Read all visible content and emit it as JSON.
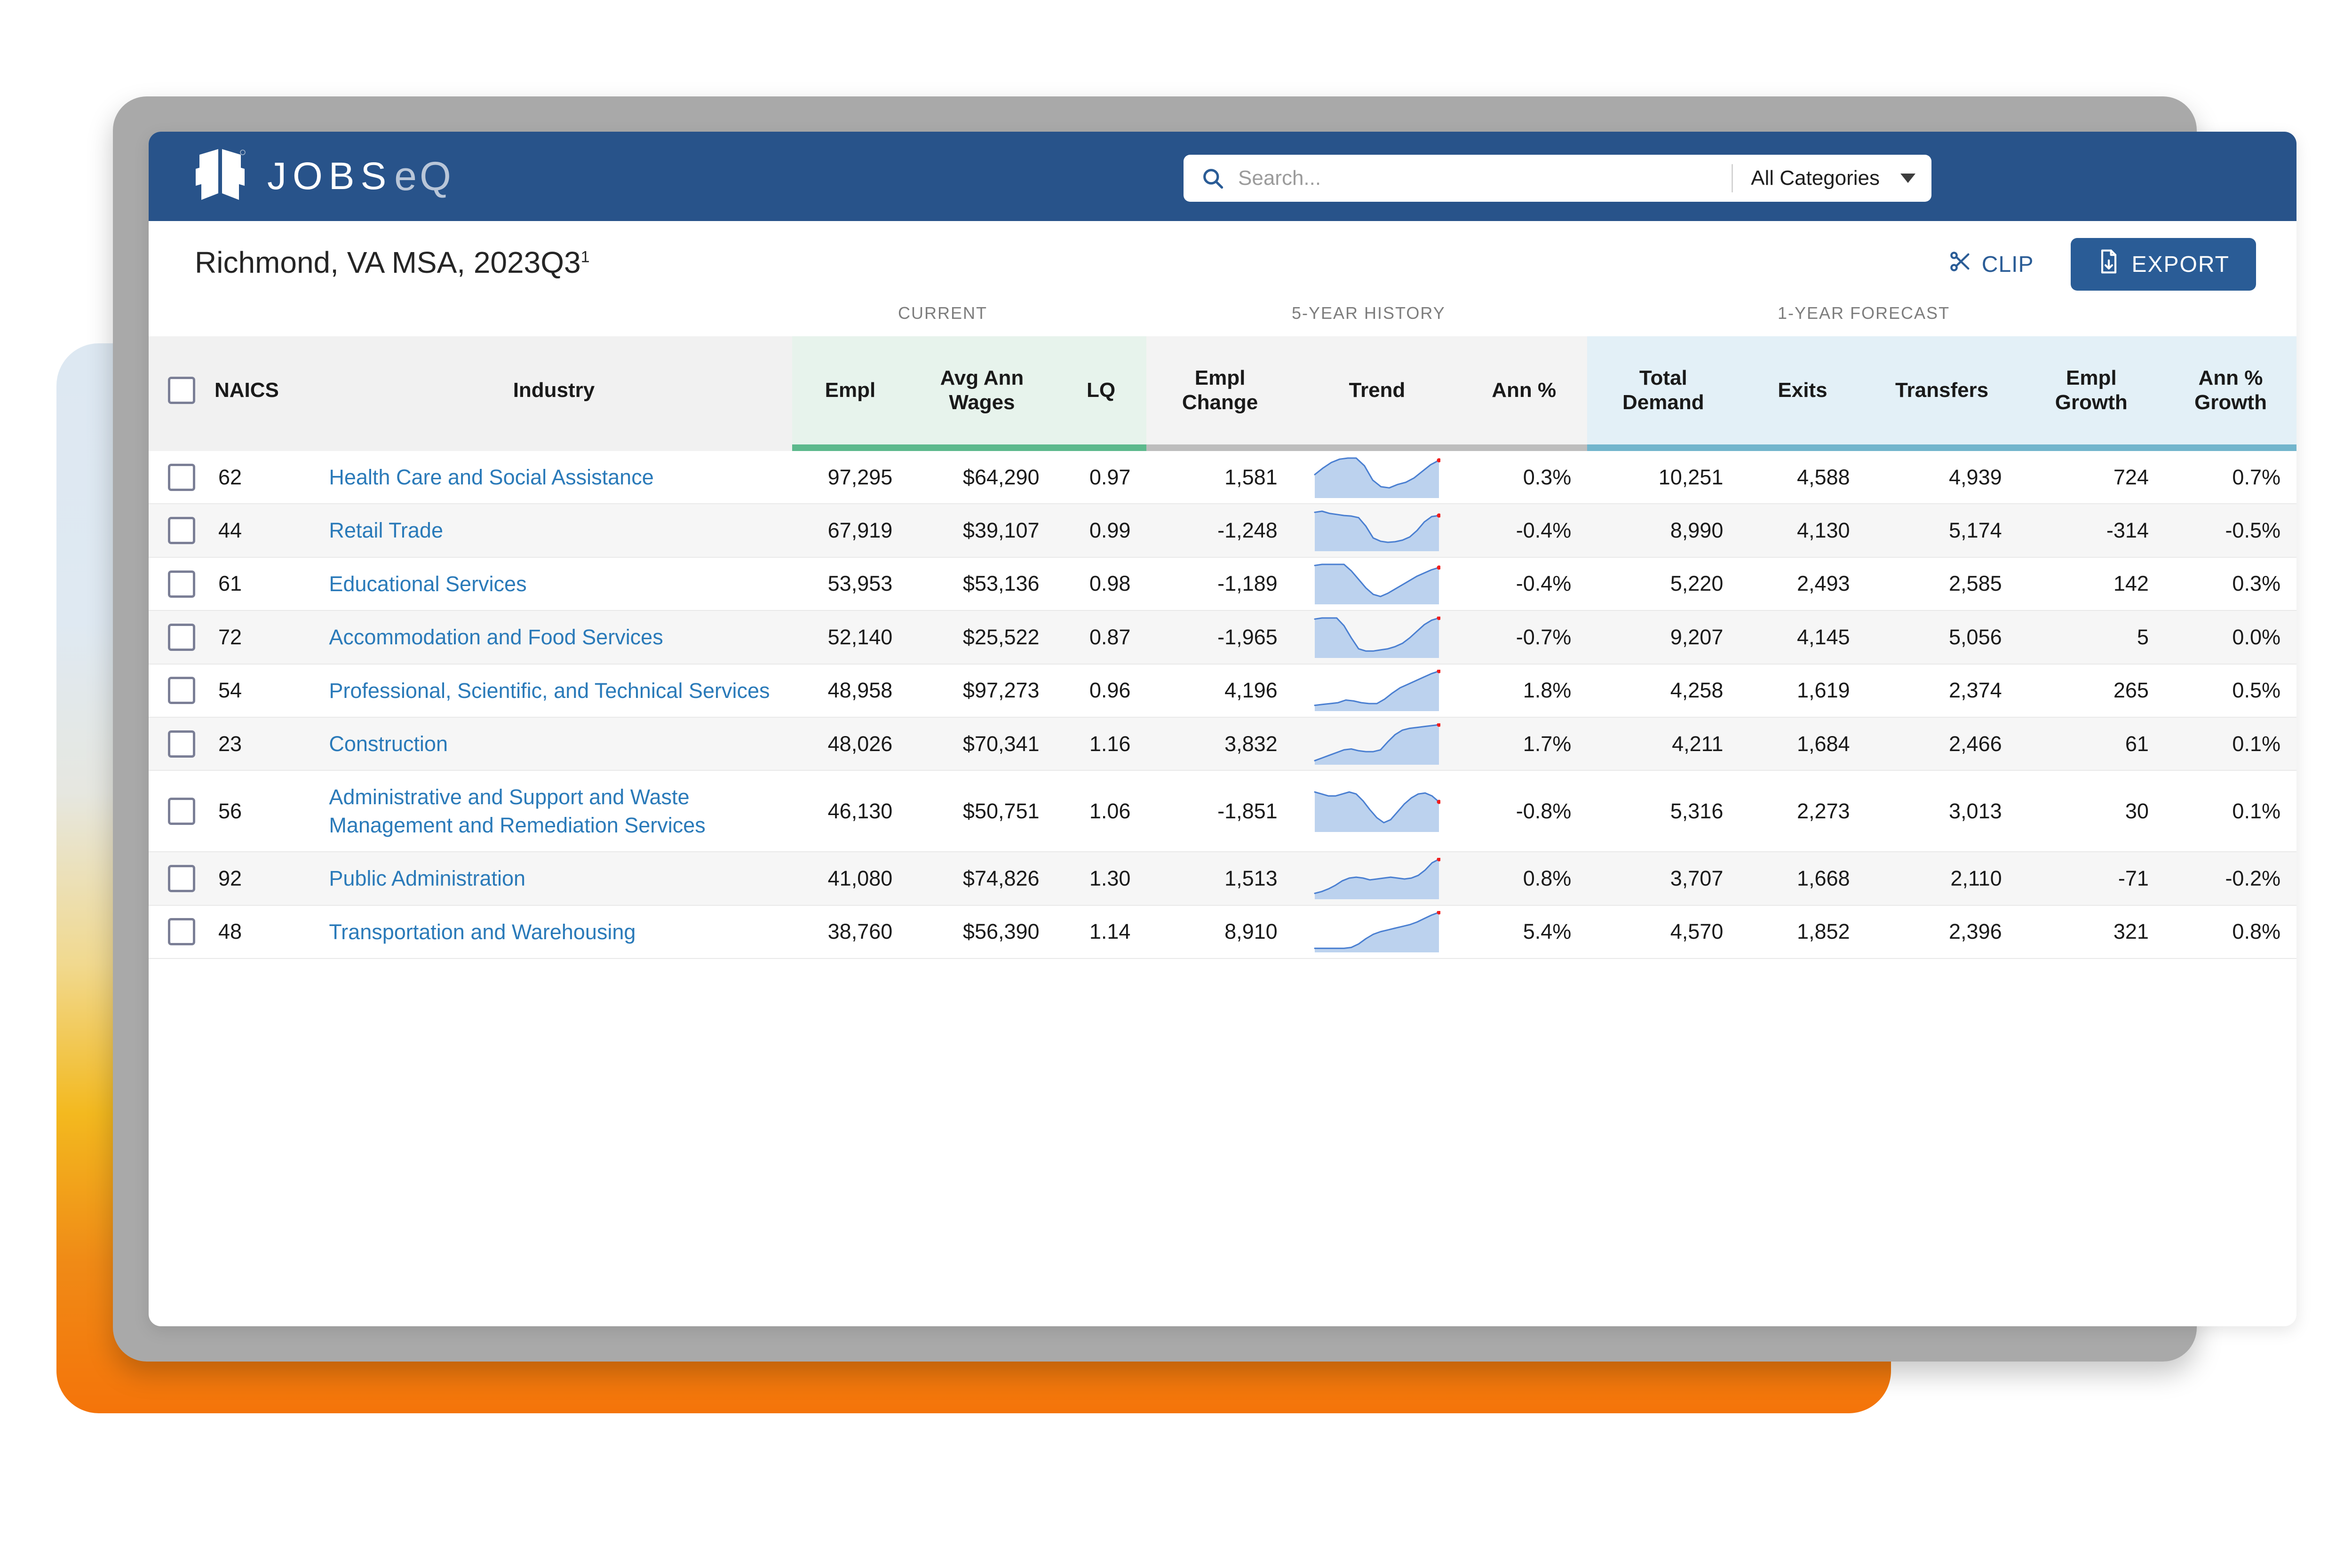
{
  "brand": {
    "name_primary": "JOBS",
    "name_secondary": "eQ",
    "logo_icon": "stacked-chevron-logo-icon"
  },
  "search": {
    "placeholder": "Search...",
    "value": "",
    "category_selected": "All Categories",
    "icon": "search-icon",
    "caret_icon": "chevron-down-icon"
  },
  "header": {
    "title": "Richmond, VA MSA, 2023Q3",
    "title_superscript": "1",
    "clip_label": "CLIP",
    "clip_icon": "scissors-icon",
    "export_label": "EXPORT",
    "export_icon": "file-download-icon"
  },
  "groups": {
    "current": "CURRENT",
    "history": "5-YEAR HISTORY",
    "forecast": "1-YEAR FORECAST"
  },
  "columns": {
    "naics": "NAICS",
    "industry": "Industry",
    "empl": "Empl",
    "avg_ann_wages_l1": "Avg Ann",
    "avg_ann_wages_l2": "Wages",
    "lq": "LQ",
    "empl_change_l1": "Empl",
    "empl_change_l2": "Change",
    "trend": "Trend",
    "ann_pct": "Ann %",
    "total_demand_l1": "Total",
    "total_demand_l2": "Demand",
    "exits": "Exits",
    "transfers": "Transfers",
    "empl_growth_l1": "Empl",
    "empl_growth_l2": "Growth",
    "ann_pct_growth_l1": "Ann %",
    "ann_pct_growth_l2": "Growth"
  },
  "colors": {
    "brand_blue": "#28538a",
    "link_blue": "#2a7ab9",
    "current_band": "#5cb98c",
    "history_band": "#bdbdbd",
    "forecast_band": "#72b5cc",
    "spark_line": "#4a7fd1",
    "spark_fill": "#bcd2ee",
    "spark_marker": "#f01e1e"
  },
  "rows": [
    {
      "naics": "62",
      "industry": "Health Care and Social Assistance",
      "empl": "97,295",
      "wages": "$64,290",
      "lq": "0.97",
      "empl_change": "1,581",
      "ann_pct": "0.3%",
      "total_demand": "10,251",
      "exits": "4,588",
      "transfers": "4,939",
      "empl_growth": "724",
      "ann_pct_growth": "0.7%"
    },
    {
      "naics": "44",
      "industry": "Retail Trade",
      "empl": "67,919",
      "wages": "$39,107",
      "lq": "0.99",
      "empl_change": "-1,248",
      "ann_pct": "-0.4%",
      "total_demand": "8,990",
      "exits": "4,130",
      "transfers": "5,174",
      "empl_growth": "-314",
      "ann_pct_growth": "-0.5%"
    },
    {
      "naics": "61",
      "industry": "Educational Services",
      "empl": "53,953",
      "wages": "$53,136",
      "lq": "0.98",
      "empl_change": "-1,189",
      "ann_pct": "-0.4%",
      "total_demand": "5,220",
      "exits": "2,493",
      "transfers": "2,585",
      "empl_growth": "142",
      "ann_pct_growth": "0.3%"
    },
    {
      "naics": "72",
      "industry": "Accommodation and Food Services",
      "empl": "52,140",
      "wages": "$25,522",
      "lq": "0.87",
      "empl_change": "-1,965",
      "ann_pct": "-0.7%",
      "total_demand": "9,207",
      "exits": "4,145",
      "transfers": "5,056",
      "empl_growth": "5",
      "ann_pct_growth": "0.0%"
    },
    {
      "naics": "54",
      "industry": "Professional, Scientific, and Technical Services",
      "empl": "48,958",
      "wages": "$97,273",
      "lq": "0.96",
      "empl_change": "4,196",
      "ann_pct": "1.8%",
      "total_demand": "4,258",
      "exits": "1,619",
      "transfers": "2,374",
      "empl_growth": "265",
      "ann_pct_growth": "0.5%"
    },
    {
      "naics": "23",
      "industry": "Construction",
      "empl": "48,026",
      "wages": "$70,341",
      "lq": "1.16",
      "empl_change": "3,832",
      "ann_pct": "1.7%",
      "total_demand": "4,211",
      "exits": "1,684",
      "transfers": "2,466",
      "empl_growth": "61",
      "ann_pct_growth": "0.1%"
    },
    {
      "naics": "56",
      "industry": "Administrative and Support and Waste Management and Remediation Services",
      "empl": "46,130",
      "wages": "$50,751",
      "lq": "1.06",
      "empl_change": "-1,851",
      "ann_pct": "-0.8%",
      "total_demand": "5,316",
      "exits": "2,273",
      "transfers": "3,013",
      "empl_growth": "30",
      "ann_pct_growth": "0.1%"
    },
    {
      "naics": "92",
      "industry": "Public Administration",
      "empl": "41,080",
      "wages": "$74,826",
      "lq": "1.30",
      "empl_change": "1,513",
      "ann_pct": "0.8%",
      "total_demand": "3,707",
      "exits": "1,668",
      "transfers": "2,110",
      "empl_growth": "-71",
      "ann_pct_growth": "-0.2%"
    },
    {
      "naics": "48",
      "industry": "Transportation and Warehousing",
      "empl": "38,760",
      "wages": "$56,390",
      "lq": "1.14",
      "empl_change": "8,910",
      "ann_pct": "5.4%",
      "total_demand": "4,570",
      "exits": "1,852",
      "transfers": "2,396",
      "empl_growth": "321",
      "ann_pct_growth": "0.8%"
    }
  ],
  "chart_data": [
    {
      "type": "area",
      "title": "Trend 5-Year History — Health Care and Social Assistance",
      "x": [
        0,
        1,
        2,
        3,
        4,
        5,
        6,
        7,
        8,
        9,
        10,
        11,
        12
      ],
      "values": [
        40,
        52,
        62,
        68,
        70,
        70,
        56,
        30,
        18,
        16,
        22,
        26,
        34,
        46,
        58,
        66
      ]
    },
    {
      "type": "area",
      "title": "Trend 5-Year History — Retail Trade",
      "values": [
        70,
        72,
        68,
        66,
        64,
        63,
        60,
        44,
        22,
        16,
        14,
        15,
        18,
        24,
        36,
        52,
        62,
        64
      ]
    },
    {
      "type": "area",
      "title": "Trend 5-Year History — Educational Services",
      "values": [
        70,
        72,
        72,
        72,
        72,
        60,
        44,
        28,
        16,
        12,
        18,
        26,
        34,
        42,
        50,
        56,
        62,
        66
      ]
    },
    {
      "type": "area",
      "title": "Trend 5-Year History — Accommodation and Food Services",
      "values": [
        68,
        70,
        70,
        70,
        56,
        34,
        14,
        10,
        10,
        12,
        14,
        18,
        24,
        34,
        46,
        58,
        66,
        70
      ]
    },
    {
      "type": "area",
      "title": "Trend 5-Year History — Professional, Scientific, and Technical Services",
      "values": [
        10,
        12,
        14,
        16,
        22,
        20,
        16,
        14,
        14,
        24,
        38,
        50,
        58,
        66,
        74,
        82,
        88
      ]
    },
    {
      "type": "area",
      "title": "Trend 5-Year History — Construction",
      "values": [
        6,
        12,
        18,
        24,
        30,
        32,
        28,
        26,
        26,
        30,
        48,
        64,
        74,
        78,
        80,
        82,
        84,
        86
      ]
    },
    {
      "type": "area",
      "title": "Trend 5-Year History — Administrative and Support and Waste Management and Remediation Services",
      "values": [
        78,
        74,
        70,
        70,
        74,
        78,
        74,
        60,
        42,
        26,
        16,
        22,
        38,
        54,
        66,
        74,
        76,
        70,
        58
      ]
    },
    {
      "type": "area",
      "title": "Trend 5-Year History — Public Administration",
      "values": [
        10,
        14,
        20,
        28,
        38,
        44,
        46,
        44,
        40,
        42,
        44,
        46,
        44,
        42,
        44,
        50,
        62,
        78,
        86
      ]
    },
    {
      "type": "area",
      "title": "Trend 5-Year History — Transportation and Warehousing",
      "values": [
        6,
        6,
        6,
        6,
        6,
        8,
        16,
        28,
        38,
        44,
        48,
        52,
        56,
        60,
        66,
        74,
        82,
        88
      ]
    }
  ]
}
